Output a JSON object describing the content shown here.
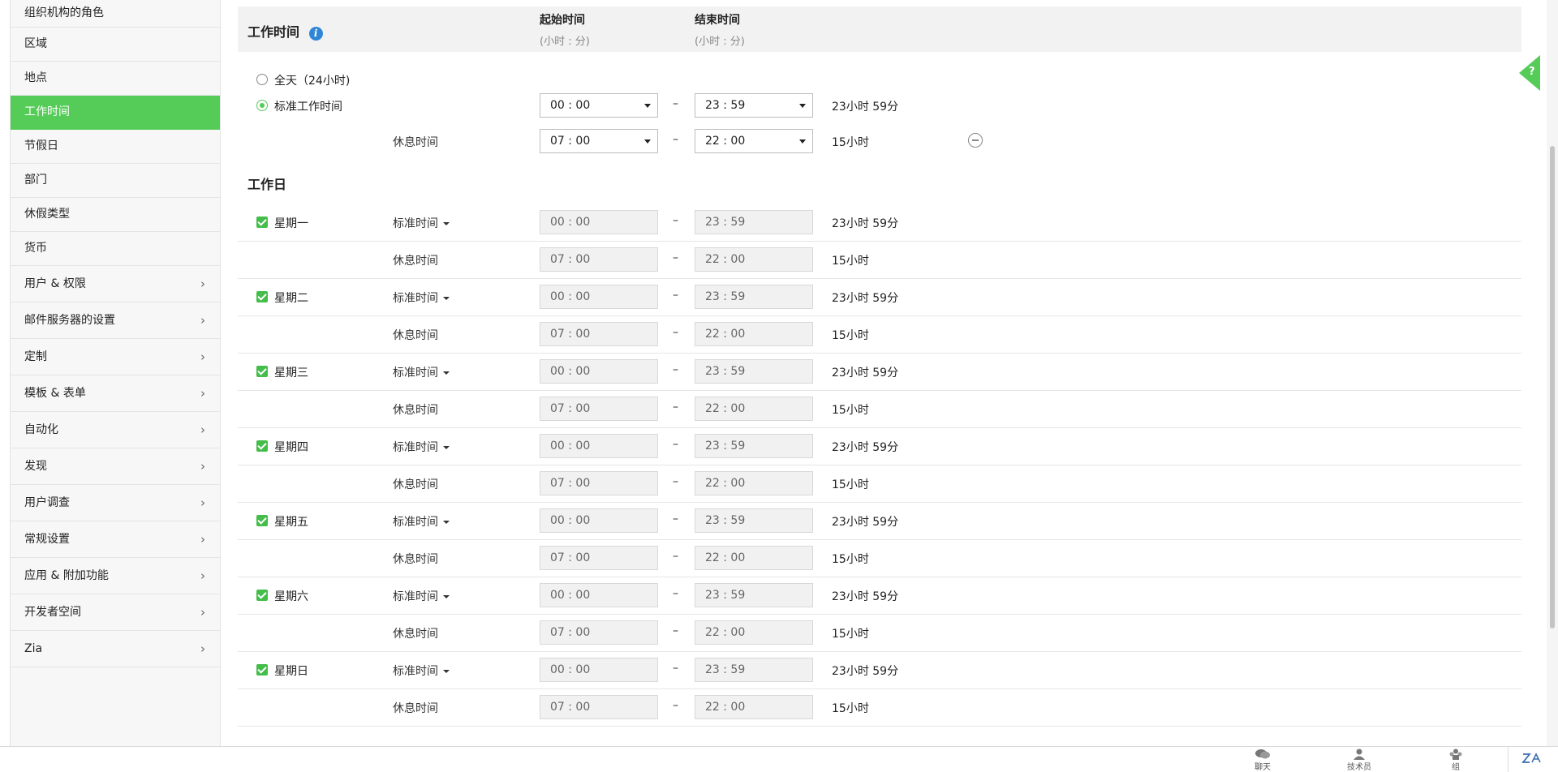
{
  "sidebar": {
    "items": [
      {
        "label": "组织机构的角色"
      },
      {
        "label": "区域"
      },
      {
        "label": "地点"
      },
      {
        "label": "工作时间"
      },
      {
        "label": "节假日"
      },
      {
        "label": "部门"
      },
      {
        "label": "休假类型"
      },
      {
        "label": "货币"
      }
    ],
    "groups": [
      {
        "label": "用户 & 权限"
      },
      {
        "label": "邮件服务器的设置"
      },
      {
        "label": "定制"
      },
      {
        "label": "模板 & 表单"
      },
      {
        "label": "自动化"
      },
      {
        "label": "发现"
      },
      {
        "label": "用户调查"
      },
      {
        "label": "常规设置"
      },
      {
        "label": "应用 & 附加功能"
      },
      {
        "label": "开发者空间"
      },
      {
        "label": "Zia"
      }
    ]
  },
  "header": {
    "title": "工作时间",
    "start_label": "起始时间",
    "start_sub": "(小时 : 分)",
    "end_label": "结束时间",
    "end_sub": "(小时 : 分)"
  },
  "options": {
    "all_day_label": "全天（24小时)",
    "standard_label": "标准工作时间",
    "selected": "standard",
    "standard_start": "00 : 00",
    "standard_end": "23 : 59",
    "standard_duration": "23小时 59分",
    "break_label": "休息时间",
    "break_start": "07 : 00",
    "break_end": "22 : 00",
    "break_duration": "15小时"
  },
  "dash": "–",
  "workdays": {
    "title": "工作日",
    "mode_label": "标准时间",
    "break_label": "休息时间",
    "days": [
      {
        "name": "星期一",
        "checked": true,
        "start": "00 : 00",
        "end": "23 : 59",
        "duration": "23小时 59分",
        "break_start": "07 : 00",
        "break_end": "22 : 00",
        "break_duration": "15小时"
      },
      {
        "name": "星期二",
        "checked": true,
        "start": "00 : 00",
        "end": "23 : 59",
        "duration": "23小时 59分",
        "break_start": "07 : 00",
        "break_end": "22 : 00",
        "break_duration": "15小时"
      },
      {
        "name": "星期三",
        "checked": true,
        "start": "00 : 00",
        "end": "23 : 59",
        "duration": "23小时 59分",
        "break_start": "07 : 00",
        "break_end": "22 : 00",
        "break_duration": "15小时"
      },
      {
        "name": "星期四",
        "checked": true,
        "start": "00 : 00",
        "end": "23 : 59",
        "duration": "23小时 59分",
        "break_start": "07 : 00",
        "break_end": "22 : 00",
        "break_duration": "15小时"
      },
      {
        "name": "星期五",
        "checked": true,
        "start": "00 : 00",
        "end": "23 : 59",
        "duration": "23小时 59分",
        "break_start": "07 : 00",
        "break_end": "22 : 00",
        "break_duration": "15小时"
      },
      {
        "name": "星期六",
        "checked": true,
        "start": "00 : 00",
        "end": "23 : 59",
        "duration": "23小时 59分",
        "break_start": "07 : 00",
        "break_end": "22 : 00",
        "break_duration": "15小时"
      },
      {
        "name": "星期日",
        "checked": true,
        "start": "00 : 00",
        "end": "23 : 59",
        "duration": "23小时 59分",
        "break_start": "07 : 00",
        "break_end": "22 : 00",
        "break_duration": "15小时"
      }
    ]
  },
  "help": {
    "label": "?"
  },
  "bottom_bar": {
    "chat_label": "聊天",
    "tech_label": "技术员",
    "group_label": "组"
  },
  "colors": {
    "accent": "#56cc58",
    "info": "#2f86d6",
    "checkbox": "#44bd4a"
  }
}
